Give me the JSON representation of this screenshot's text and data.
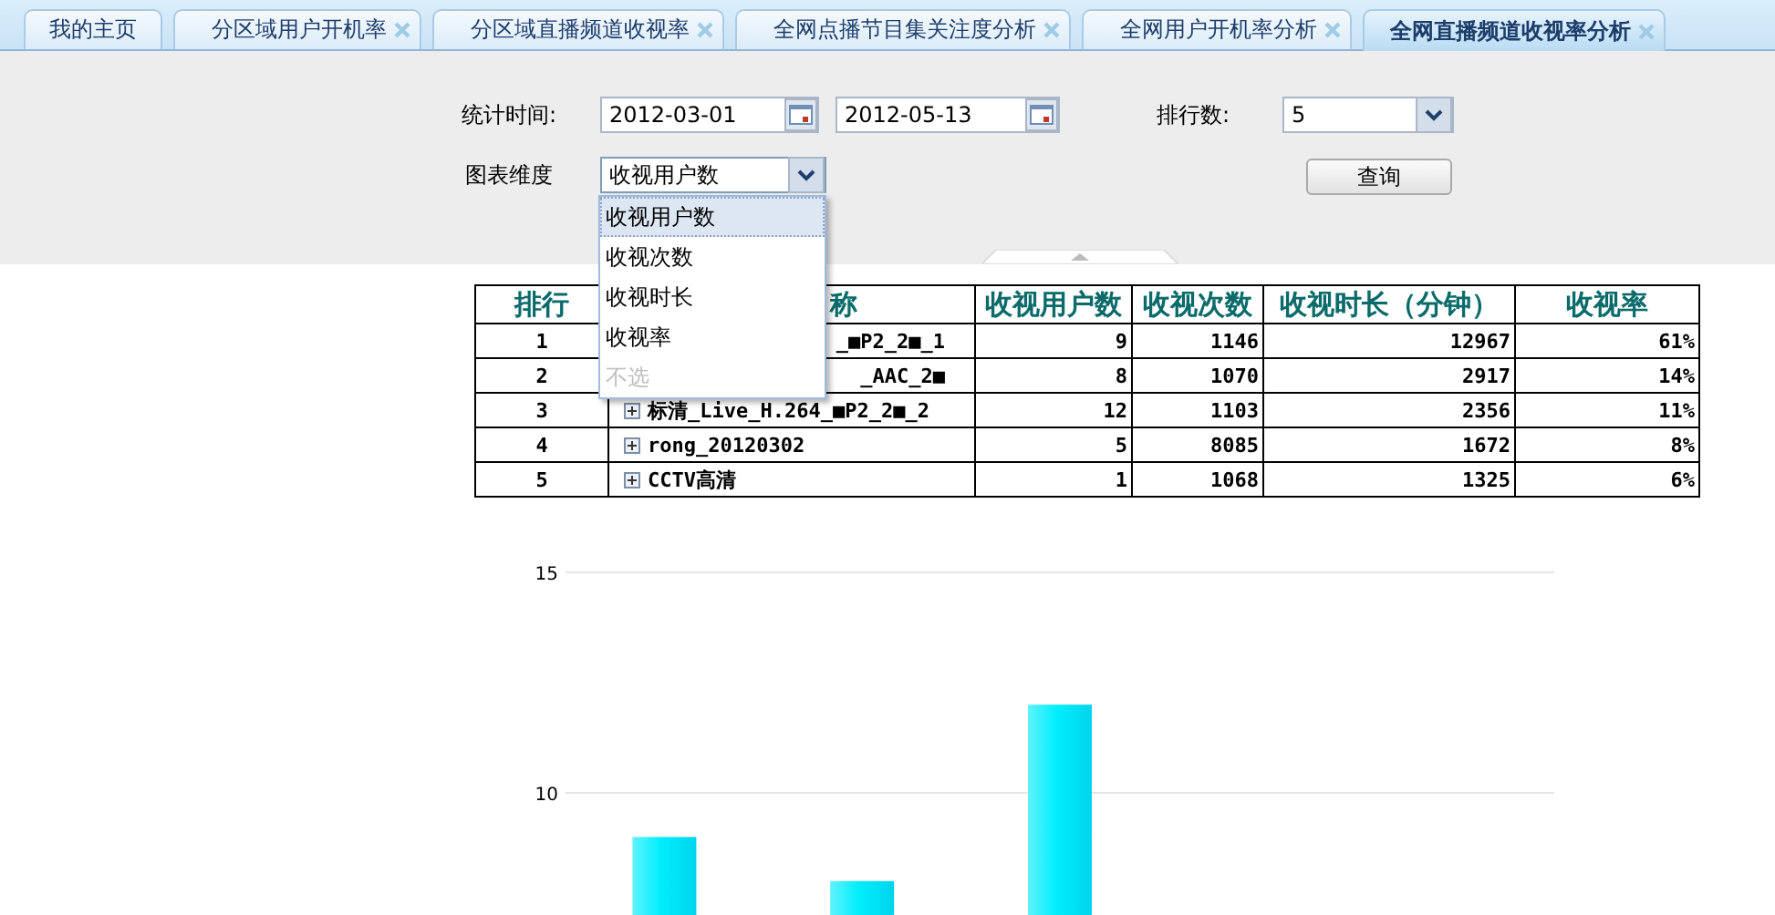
{
  "tabs": [
    {
      "label": "我的主页",
      "selected": false,
      "closable": false
    },
    {
      "label": "分区域用户开机率",
      "selected": false,
      "closable": true
    },
    {
      "label": "分区域直播频道收视率",
      "selected": false,
      "closable": true
    },
    {
      "label": "全网点播节目集关注度分析",
      "selected": false,
      "closable": true
    },
    {
      "label": "全网用户开机率分析",
      "selected": false,
      "closable": true
    },
    {
      "label": "全网直播频道收视率分析",
      "selected": true,
      "closable": true
    }
  ],
  "form": {
    "date_label": "统计时间:",
    "start_date": "2012-03-01",
    "end_date": "2012-05-13",
    "rank_label": "排行数:",
    "rank_value": "5",
    "dimension_label": "图表维度",
    "dimension_value": "收视用户数",
    "query_button": "查询"
  },
  "dropdown": {
    "items": [
      {
        "label": "收视用户数",
        "selected": true,
        "disabled": false
      },
      {
        "label": "收视次数",
        "selected": false,
        "disabled": false
      },
      {
        "label": "收视时长",
        "selected": false,
        "disabled": false
      },
      {
        "label": "收视率",
        "selected": false,
        "disabled": false
      },
      {
        "label": "不选",
        "selected": false,
        "disabled": true
      }
    ]
  },
  "table": {
    "columns": [
      "排行",
      "称",
      "收视用户数",
      "收视次数",
      "收视时长（分钟）",
      "收视率"
    ],
    "rows": [
      {
        "rank": "1",
        "name": "_■P2_2■_1",
        "kind": "covered",
        "users": "9",
        "views": "1146",
        "minutes": "12967",
        "rate": "61%"
      },
      {
        "rank": "2",
        "name": "_AAC_2■",
        "kind": "covered",
        "users": "8",
        "views": "1070",
        "minutes": "2917",
        "rate": "14%"
      },
      {
        "rank": "3",
        "name": "标清_Live_H.264_■P2_2■_2",
        "kind": "full",
        "users": "12",
        "views": "1103",
        "minutes": "2356",
        "rate": "11%"
      },
      {
        "rank": "4",
        "name": "rong_20120302",
        "kind": "full",
        "users": "5",
        "views": "8085",
        "minutes": "1672",
        "rate": "8%"
      },
      {
        "rank": "5",
        "name": "CCTV高清",
        "kind": "full",
        "users": "1",
        "views": "1068",
        "minutes": "1325",
        "rate": "6%"
      }
    ]
  },
  "chart": {
    "chart_data": {
      "type": "bar",
      "values": [
        9,
        8,
        12,
        null,
        null
      ],
      "ylim": [
        7,
        15
      ],
      "yticks": [
        10,
        15
      ]
    }
  }
}
